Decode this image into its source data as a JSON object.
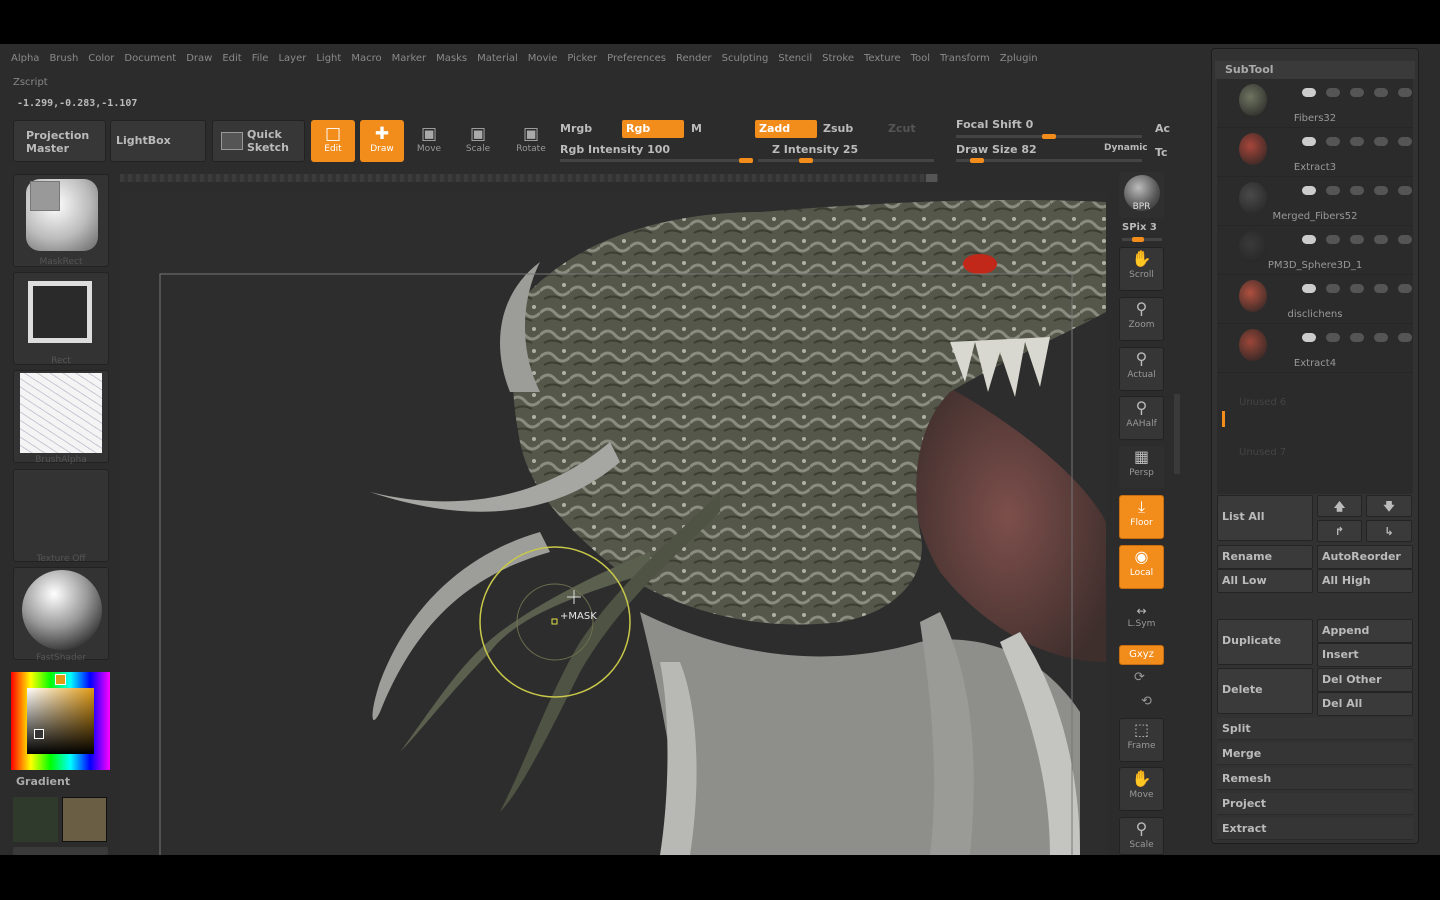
{
  "menu": [
    "Alpha",
    "Brush",
    "Color",
    "Document",
    "Draw",
    "Edit",
    "File",
    "Layer",
    "Light",
    "Macro",
    "Marker",
    "Masks",
    "Material",
    "Movie",
    "Picker",
    "Preferences",
    "Render",
    "Sculpting",
    "Stencil",
    "Stroke",
    "Texture",
    "Tool",
    "Transform",
    "Zplugin"
  ],
  "zscript": "Zscript",
  "coords": "-1.299,-0.283,-1.107",
  "toolbar": {
    "projection_master": "Projection Master",
    "lightbox": "LightBox",
    "quick_sketch": "Quick Sketch",
    "edit": "Edit",
    "draw": "Draw",
    "move": "Move",
    "scale": "Scale",
    "rotate": "Rotate",
    "mrgb": "Mrgb",
    "rgb": "Rgb",
    "m": "M",
    "rgb_intensity": "Rgb Intensity 100",
    "zadd": "Zadd",
    "zsub": "Zsub",
    "zcut": "Zcut",
    "z_intensity": "Z Intensity 25",
    "focal_shift": "Focal Shift 0",
    "draw_size": "Draw Size 82",
    "dynamic": "Dynamic",
    "ac": "Ac",
    "tc": "Tc",
    "accent": "#f28c1b",
    "rgb_intensity_value": 100,
    "z_intensity_value": 25,
    "focal_shift_value": 0,
    "draw_size_value": 82
  },
  "left_panel": {
    "mask_rect": "MaskRect",
    "rect": "Rect",
    "brush_alpha": "BrushAlpha",
    "texture_off": "Texture Off",
    "fast_shader": "FastShader",
    "gradient": "Gradient"
  },
  "canvas": {
    "cursor_label": "+MASK"
  },
  "right_toolbar": {
    "bpr": "BPR",
    "spix": "SPix 3",
    "scroll": "Scroll",
    "zoom": "Zoom",
    "actual": "Actual",
    "aahalf": "AAHalf",
    "persp": "Persp",
    "floor": "Floor",
    "local": "Local",
    "lsym": "L.Sym",
    "xyz": "Gxyz",
    "frame": "Frame",
    "move": "Move",
    "scale": "Scale"
  },
  "subtool": {
    "title": "SubTool",
    "items": [
      {
        "name": "Fibers32",
        "color": "#6f7460"
      },
      {
        "name": "Extract3",
        "color": "#a8463a"
      },
      {
        "name": "Merged_Fibers52",
        "color": "#4a4a4a"
      },
      {
        "name": "PM3D_Sphere3D_1",
        "color": "#3a3a3a"
      },
      {
        "name": "disclichens",
        "color": "#b0503f"
      },
      {
        "name": "Extract4",
        "color": "#9b4638"
      }
    ],
    "unused_6": "Unused 6",
    "unused_7": "Unused 7",
    "list_all": "List All",
    "rename": "Rename",
    "auto_reorder": "AutoReorder",
    "all_low": "All Low",
    "all_high": "All High",
    "duplicate": "Duplicate",
    "append": "Append",
    "insert": "Insert",
    "delete": "Delete",
    "del_other": "Del Other",
    "del_all": "Del All",
    "split": "Split",
    "merge": "Merge",
    "remesh": "Remesh",
    "project": "Project",
    "extract": "Extract"
  }
}
